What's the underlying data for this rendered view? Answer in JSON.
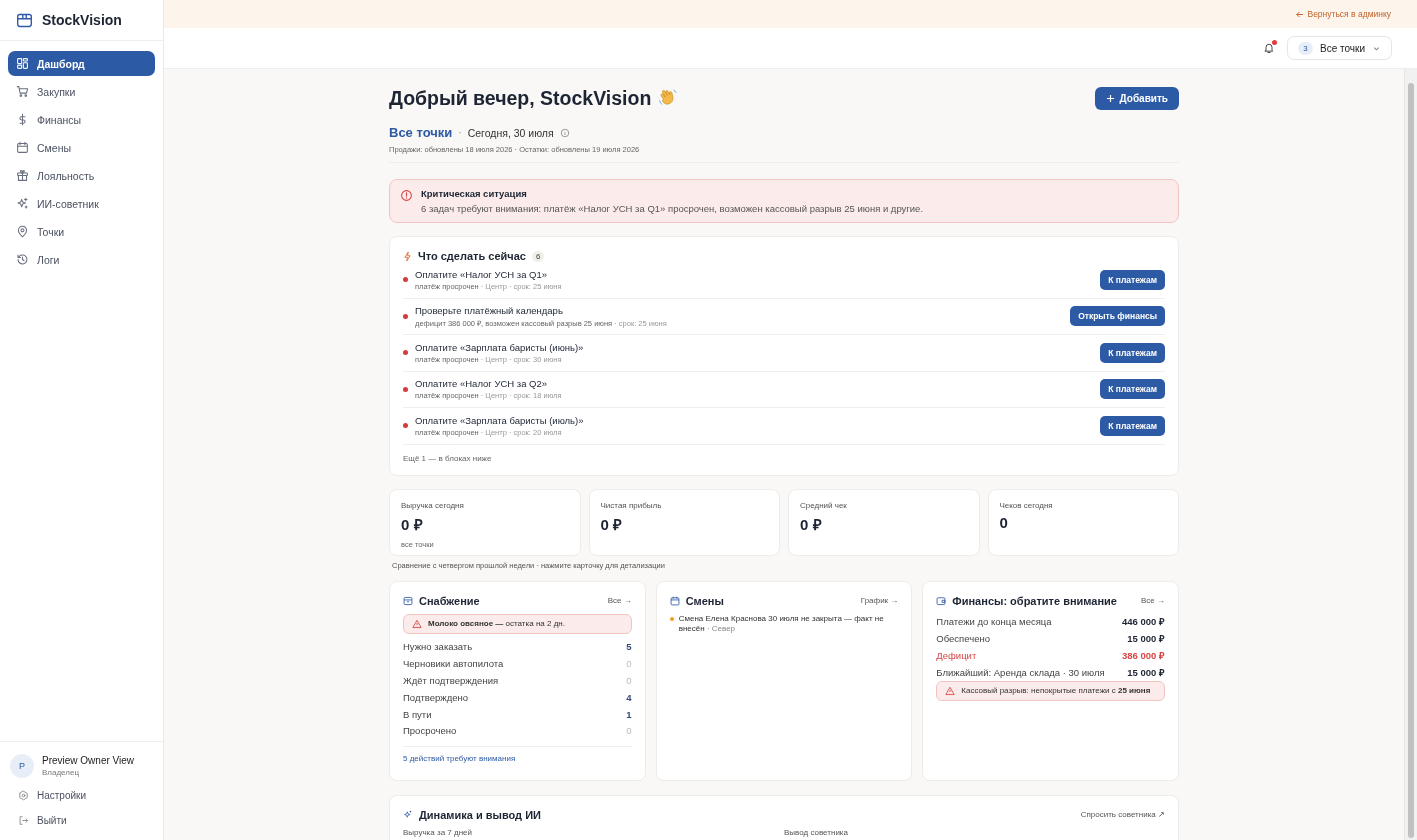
{
  "sidebar": {
    "brand": "StockVision",
    "items": [
      {
        "label": "Дашборд",
        "selected": true
      },
      {
        "label": "Закупки",
        "selected": false
      },
      {
        "label": "Финансы",
        "selected": false
      },
      {
        "label": "Смены",
        "selected": false
      },
      {
        "label": "Лояльность",
        "selected": false
      },
      {
        "label": "ИИ-советник",
        "selected": false
      },
      {
        "label": "Точки",
        "selected": false
      },
      {
        "label": "Логи",
        "selected": false
      }
    ],
    "user": {
      "initial": "P",
      "name": "Preview Owner View",
      "role": "Владелец"
    },
    "footer_links": [
      {
        "label": "Настройки"
      },
      {
        "label": "Выйти"
      }
    ]
  },
  "banner": {
    "link": "Вернуться в админку"
  },
  "header": {
    "notifications_unread": true,
    "location_picker": {
      "count": "3",
      "label": "Все точки"
    }
  },
  "greeting": {
    "title": "Добрый вечер, StockVision",
    "add_button": "Добавить"
  },
  "scope": {
    "location": "Все точки",
    "separator": "·",
    "date": "Сегодня, 30 июля",
    "updated": "Продажи: обновлены 18 июля 2026 · Остатки: обновлены 19 июля 2026"
  },
  "alert": {
    "title": "Критическая ситуация",
    "text": "6 задач требуют внимания: платёж «Налог УСН за Q1» просрочен, возможен кассовый разрыв 25 июня и другие."
  },
  "todo": {
    "title": "Что сделать сейчас",
    "count": "6",
    "items": [
      {
        "title": "Оплатите «Налог УСН за Q1»",
        "status": "платёж просрочен",
        "details": "· Центр · срок: 25 июня",
        "action": "К платежам"
      },
      {
        "title": "Проверьте платёжный календарь",
        "status": "дефицит 386 000 ₽, возможен кассовый разрыв 25 июня",
        "details": "· срок: 25 июня",
        "action": "Открыть финансы"
      },
      {
        "title": "Оплатите «Зарплата баристы (июнь)»",
        "status": "платёж просрочен",
        "details": "· Центр · срок: 30 июня",
        "action": "К платежам"
      },
      {
        "title": "Оплатите «Налог УСН за Q2»",
        "status": "платёж просрочен",
        "details": "· Центр · срок: 18 июля",
        "action": "К платежам"
      },
      {
        "title": "Оплатите «Зарплата баристы (июль)»",
        "status": "платёж просрочен",
        "details": "· Центр · срок: 20 июля",
        "action": "К платежам"
      }
    ],
    "more": "Ещё 1 — в блоках ниже"
  },
  "kpis": [
    {
      "label": "Выручка сегодня",
      "value": "0 ₽",
      "note": "все точки"
    },
    {
      "label": "Чистая прибыль",
      "value": "0 ₽"
    },
    {
      "label": "Средний чек",
      "value": "0 ₽"
    },
    {
      "label": "Чеков сегодня",
      "value": "0"
    }
  ],
  "kpi_note": "Сравнение с четвергом прошлой недели · нажмите карточку для детализации",
  "supply": {
    "title": "Снабжение",
    "link": "Все →",
    "alert": "**Молоко овсяное —** остатка на 2 дн.",
    "rows": [
      {
        "label": "Нужно заказать",
        "value": "5",
        "muted": false
      },
      {
        "label": "Черновики автопилота",
        "value": "0",
        "muted": true
      },
      {
        "label": "Ждёт подтверждения",
        "value": "0",
        "muted": true
      },
      {
        "label": "Подтверждено",
        "value": "4",
        "muted": false
      },
      {
        "label": "В пути",
        "value": "1",
        "muted": false
      },
      {
        "label": "Просрочено",
        "value": "0",
        "muted": true
      }
    ],
    "footer": "5 действий требуют внимания"
  },
  "shifts": {
    "title": "Смены",
    "link": "График →",
    "items": [
      {
        "text": "Смена Елена Краснова 30 июля не закрыта — факт не внесён",
        "location": "· Север",
        "color": "#f0a020"
      }
    ]
  },
  "finance": {
    "title": "Финансы: обратите внимание",
    "link": "Все →",
    "rows": [
      {
        "label": "Платежи до конца месяца",
        "value": "446 000 ₽",
        "negative": false
      },
      {
        "label": "Обеспечено",
        "value": "15 000 ₽",
        "negative": false
      },
      {
        "label": "Дефицит",
        "value": "386 000 ₽",
        "negative": true
      },
      {
        "label": "Ближайший: Аренда склада · 30 июля",
        "value": "15 000 ₽",
        "negative": false
      }
    ],
    "alert": "Кассовый разрыв: непокрытые платежи с **25 июня**"
  },
  "dynamics": {
    "title": "Динамика и вывод ИИ",
    "link": "Спросить советника ↗",
    "columns": [
      "Выручка за 7 дней",
      "Вывод советника"
    ]
  }
}
